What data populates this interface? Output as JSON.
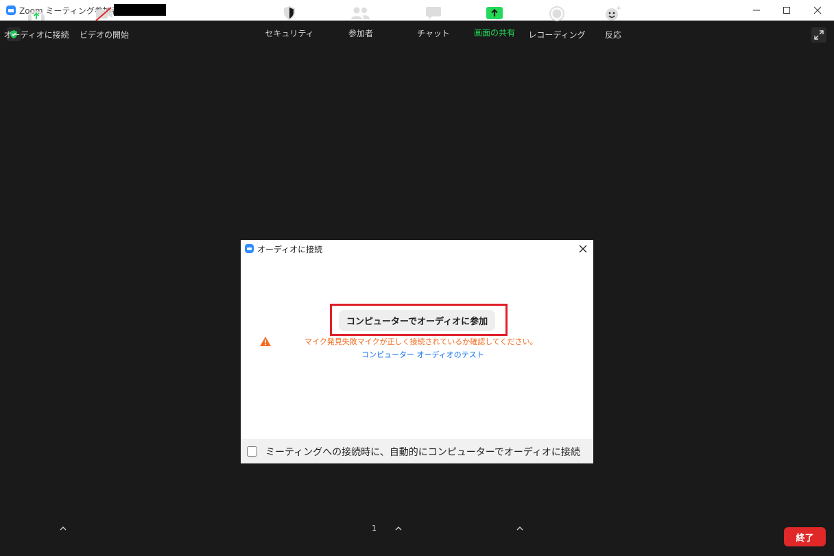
{
  "window": {
    "title": "Zoom ミーティング参加者ID："
  },
  "dialog": {
    "title": "オーディオに接続",
    "join_button": "コンピューターでオーディオに参加",
    "warning": "マイク発見失敗マイクが正しく接続されているか確認してください。",
    "test_link": "コンピューター オーディオのテスト",
    "auto_join_label": "ミーティングへの接続時に、自動的にコンピューターでオーディオに接続"
  },
  "toolbar": {
    "audio": "オーディオに接続",
    "video": "ビデオの開始",
    "security": "セキュリティ",
    "participants": "参加者",
    "participant_count": "1",
    "chat": "チャット",
    "share": "画面の共有",
    "record": "レコーディング",
    "reactions": "反応",
    "end": "終了"
  },
  "colors": {
    "accent": "#2d8cff",
    "end": "#e02828",
    "share": "#23d959",
    "warning": "#f26d21",
    "link": "#0e71eb",
    "highlight": "#e0202a"
  }
}
